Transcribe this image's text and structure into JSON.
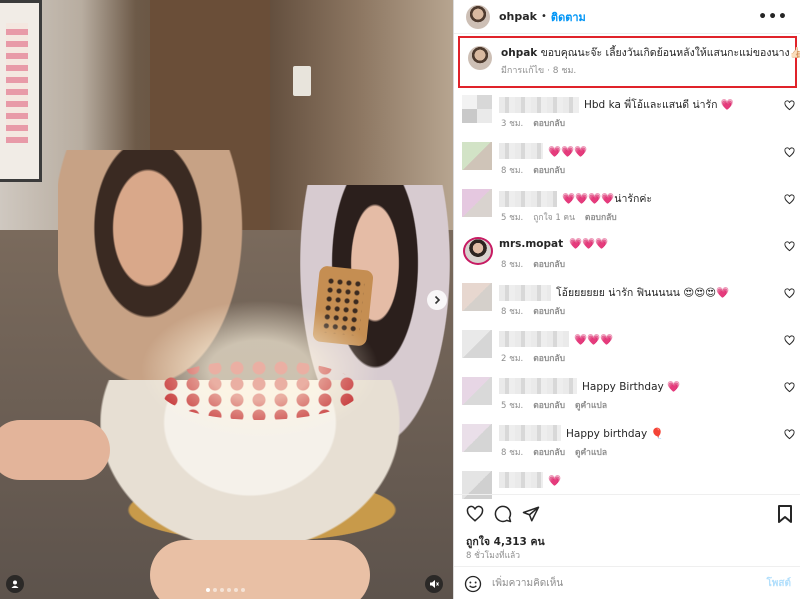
{
  "post": {
    "username": "ohpak",
    "follow_label": "ติดตาม",
    "more_label": "•••",
    "separator": "•"
  },
  "caption": {
    "username": "ohpak",
    "text": "ขอบคุณนะจ๊ะ เลี้ยงวันเกิดย้อนหลังให้แสนกะแม่ของนาง👍🏻🥰",
    "edited": "มีการแก้ไข",
    "time": "8 ชม."
  },
  "comments": [
    {
      "name": "",
      "text": "Hbd ka พี่โอ้และแสนดี น่ารัก 💗",
      "time": "3 ชม.",
      "likes": "",
      "reply": "ตอบกลับ",
      "translate": ""
    },
    {
      "name": "",
      "text": "💗💗💗",
      "time": "8 ชม.",
      "likes": "",
      "reply": "ตอบกลับ",
      "translate": ""
    },
    {
      "name": "",
      "text": "💗💗💗💗น่ารักค่ะ",
      "time": "5 ชม.",
      "likes": "ถูกใจ 1 คน",
      "reply": "ตอบกลับ",
      "translate": ""
    },
    {
      "name": "mrs.mopat",
      "text": "💗💗💗",
      "time": "8 ชม.",
      "likes": "",
      "reply": "ตอบกลับ",
      "translate": ""
    },
    {
      "name": "",
      "text": "โอ้ยยยยยย น่ารัก ฟินนนนน 😍😍😍💗",
      "time": "8 ชม.",
      "likes": "",
      "reply": "ตอบกลับ",
      "translate": ""
    },
    {
      "name": "",
      "text": "💗💗💗",
      "time": "2 ชม.",
      "likes": "",
      "reply": "ตอบกลับ",
      "translate": ""
    },
    {
      "name": "",
      "text": "Happy Birthday 💗",
      "time": "5 ชม.",
      "likes": "",
      "reply": "ตอบกลับ",
      "translate": "ดูคำแปล"
    },
    {
      "name": "",
      "text": "Happy birthday 🎈",
      "time": "8 ชม.",
      "likes": "",
      "reply": "ตอบกลับ",
      "translate": "ดูคำแปล"
    },
    {
      "name": "",
      "text": "💗",
      "time": "",
      "likes": "",
      "reply": "",
      "translate": ""
    }
  ],
  "footer": {
    "likes": "ถูกใจ 4,313 คน",
    "time_ago": "8 ชั่วโมงที่แล้ว",
    "add_comment_placeholder": "เพิ่มความคิดเห็น",
    "post_label": "โพสต์"
  },
  "carousel": {
    "slides": 6,
    "active": 0
  },
  "colors": {
    "accent": "#0095f6",
    "highlight_border": "#e0232a",
    "muted": "#8e8e8e",
    "post_disabled": "#b2dffc"
  },
  "icons": [
    "more-icon",
    "chevron-right-icon",
    "user-tag-icon",
    "mute-icon",
    "heart-icon",
    "comment-icon",
    "share-icon",
    "save-icon",
    "emoji-icon"
  ]
}
